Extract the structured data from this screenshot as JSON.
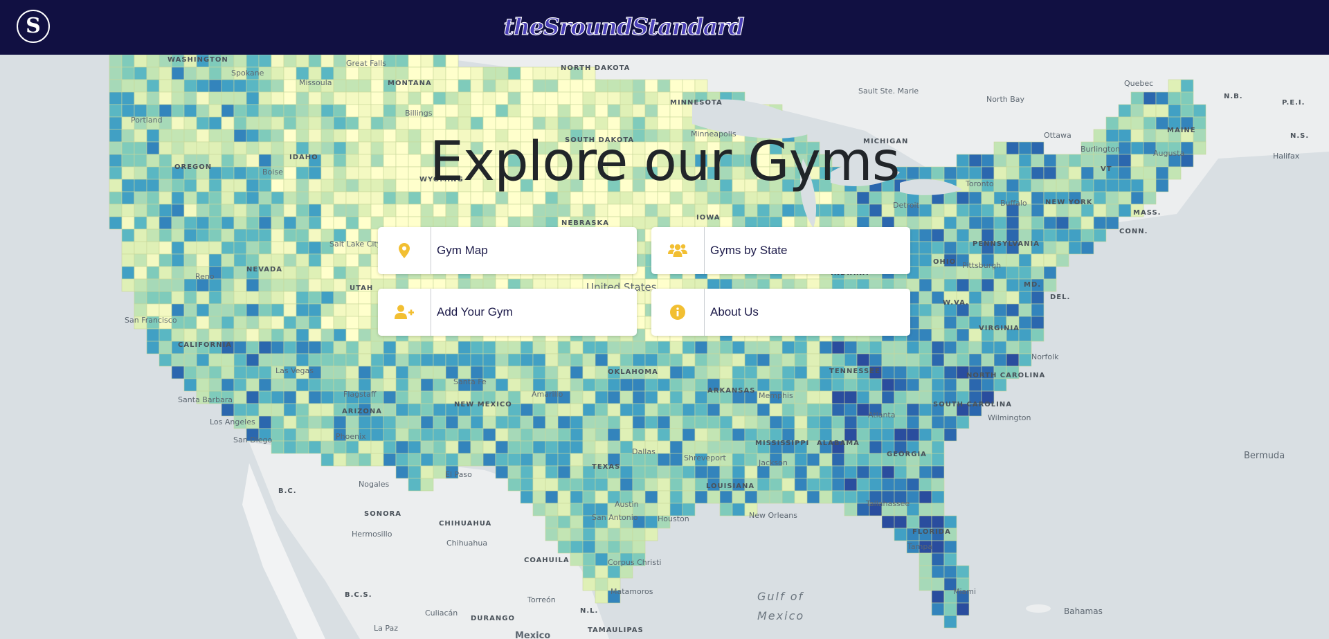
{
  "header": {
    "logo_letter": "S",
    "brand": "theSroundStandard"
  },
  "hero": {
    "title": "Explore our Gyms"
  },
  "buttons": [
    {
      "label": "Gym Map",
      "icon": "map-pin-icon"
    },
    {
      "label": "Gyms by State",
      "icon": "users-icon"
    },
    {
      "label": "Add Your Gym",
      "icon": "user-plus-icon"
    },
    {
      "label": "About Us",
      "icon": "info-icon"
    }
  ],
  "colors": {
    "nav": "#111042",
    "icon_accent": "#f2bf32",
    "map_dark": "#1f2f8f",
    "map_light": "#ffffcc"
  },
  "map_labels": {
    "washington": "WASHINGTON",
    "spokane": "Spokane",
    "great_falls": "Great Falls",
    "missoula": "Missoula",
    "montana": "MONTANA",
    "north_dakota": "NORTH DAKOTA",
    "minnesota": "MINNESOTA",
    "sault": "Sault Ste. Marie",
    "north_bay": "North Bay",
    "quebec": "Quebec",
    "nb": "N.B.",
    "pei": "P.E.I.",
    "ns": "N.S.",
    "halifax": "Halifax",
    "portland": "Portland",
    "billings": "Billings",
    "ottawa": "Ottawa",
    "burlington": "Burlington",
    "maine": "MAINE",
    "augusta": "Augusta",
    "oregon": "OREGON",
    "idaho": "IDAHO",
    "boise": "Boise",
    "south_dakota": "SOUTH DAKOTA",
    "minneapolis": "Minneapolis",
    "michigan": "MICHIGAN",
    "wyoming": "WYOMING",
    "toronto": "Toronto",
    "buffalo": "Buffalo",
    "new_york": "NEW YORK",
    "vt": "VT",
    "mass": "MASS.",
    "conn": "CONN.",
    "iowa": "IOWA",
    "detroit": "Detroit",
    "nebraska": "NEBRASKA",
    "nevada": "NEVADA",
    "salt_lake": "Salt Lake City",
    "pennsylvania": "PENNSYLVANIA",
    "pittsburgh": "Pittsburgh",
    "reno": "Reno",
    "utah": "UTAH",
    "united_states": "United States",
    "indiana": "INDIANA",
    "ohio": "OHIO",
    "md": "MD.",
    "del": "DEL.",
    "wva": "W.VA.",
    "virginia": "VIRGINIA",
    "san_francisco": "San Francisco",
    "california": "CALIFORNIA",
    "las_vegas": "Las Vegas",
    "oklahoma": "OKLAHOMA",
    "tennessee": "TENNESSEE",
    "norfolk": "Norfolk",
    "north_carolina": "NORTH CAROLINA",
    "santa_fe": "Santa Fe",
    "arkansas": "ARKANSAS",
    "memphis": "Memphis",
    "santa_barbara": "Santa Barbara",
    "flagstaff": "Flagstaff",
    "amarillo": "Amarillo",
    "new_mexico": "NEW MEXICO",
    "atlanta": "Atlanta",
    "south_carolina": "SOUTH CAROLINA",
    "wilmington": "Wilmington",
    "los_angeles": "Los Angeles",
    "arizona": "ARIZONA",
    "dallas": "Dallas",
    "shreveport": "Shreveport",
    "mississippi": "MISSISSIPPI",
    "alabama": "ALABAMA",
    "georgia": "GEORGIA",
    "san_diego": "San Diego",
    "phoenix": "Phoenix",
    "texas": "TEXAS",
    "jackson": "Jackson",
    "bermuda": "Bermuda",
    "el_paso": "El Paso",
    "nogales": "Nogales",
    "bc": "B.C.",
    "louisiana": "LOUISIANA",
    "tallahassee": "Tallahassee",
    "sonora": "SONORA",
    "austin": "Austin",
    "houston": "Houston",
    "new_orleans": "New Orleans",
    "chihuahua_state": "CHIHUAHUA",
    "hermosillo": "Hermosillo",
    "san_antonio": "San Antonio",
    "florida": "FLORIDA",
    "chihuahua": "Chihuahua",
    "tampa": "Tampa",
    "coahuila": "COAHUILA",
    "corpus_christi": "Corpus Christi",
    "matamoros": "Matamoros",
    "gulf1": "Gulf of",
    "gulf2": "Mexico",
    "miami": "Miami",
    "bcs": "B.C.S.",
    "torreon": "Torreón",
    "bahamas": "Bahamas",
    "culiacan": "Culiacán",
    "durango": "DURANGO",
    "nl": "N.L.",
    "tamaulipas": "TAMAULIPAS",
    "la_paz": "La Paz",
    "mexico": "Mexico"
  }
}
